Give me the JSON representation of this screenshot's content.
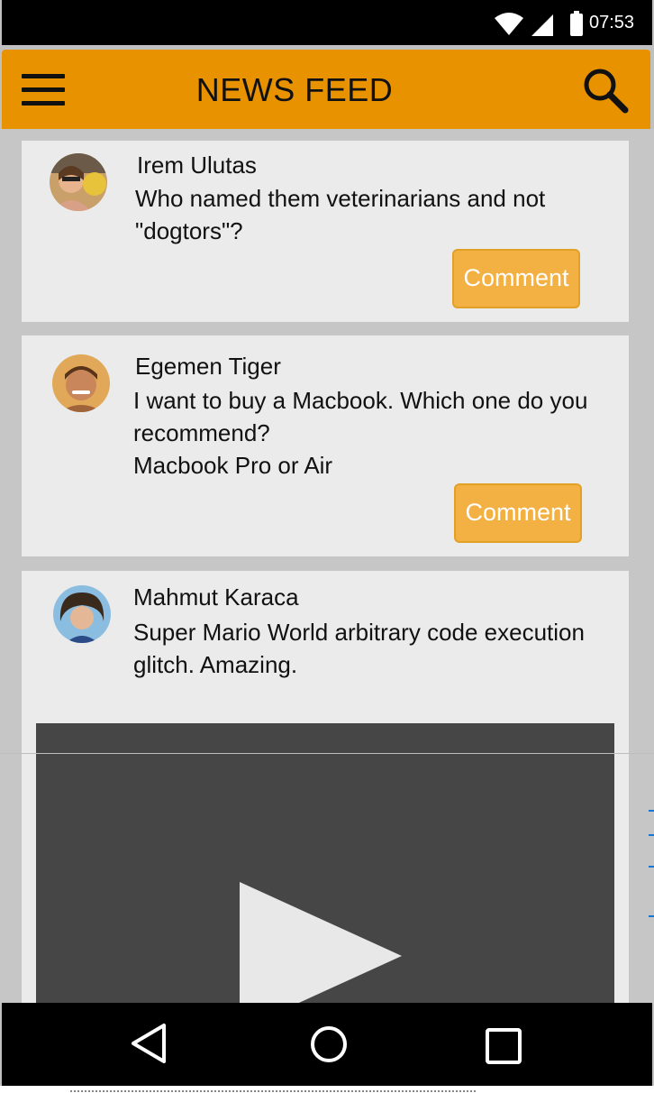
{
  "status_bar": {
    "time": "07:53",
    "icons": [
      "wifi-icon",
      "signal-icon",
      "battery-icon"
    ]
  },
  "app_bar": {
    "title": "NEWS FEED",
    "menu_icon": "hamburger-menu-icon",
    "search_icon": "search-icon",
    "color": "#e89200"
  },
  "posts": [
    {
      "author": "Irem Ulutas",
      "text": "Who named them veterinarians and not \"dogtors\"?",
      "comment_label": "Comment"
    },
    {
      "author": "Egemen Tiger",
      "text_line1": "I want to buy a Macbook. Which one do you recommend?",
      "text_line2": "Macbook Pro or Air",
      "comment_label": "Comment"
    },
    {
      "author": "Mahmut Karaca",
      "text": "Super Mario World arbitrary code execution glitch. Amazing.",
      "media": "video-player"
    }
  ],
  "nav_bar": {
    "icons": [
      "back-icon",
      "home-icon",
      "recent-apps-icon"
    ]
  },
  "colors": {
    "accent": "#e89200",
    "button": "#f3b043",
    "card": "#ebebeb",
    "background": "#c6c6c6"
  }
}
